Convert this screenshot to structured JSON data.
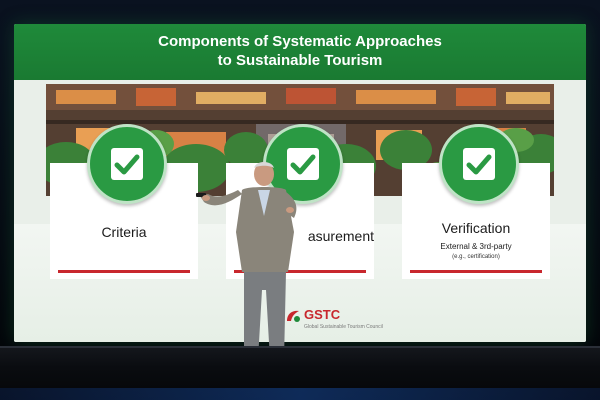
{
  "slide": {
    "title_line1": "Components of Systematic Approaches",
    "title_line2": "to Sustainable Tourism",
    "cards": [
      {
        "label": "Criteria",
        "subtitle": "",
        "note": ""
      },
      {
        "label": "Measurement",
        "visible_label": "asurement",
        "subtitle": "",
        "note": ""
      },
      {
        "label": "Verification",
        "subtitle": "External & 3rd-party",
        "note": "(e.g., certification)"
      }
    ],
    "logo": {
      "name": "GSTC",
      "tagline": "Global Sustainable Tourism Council",
      "visible_tagline": "Global Sustainable Tourism Council"
    }
  },
  "colors": {
    "header_green": "#1f8a3a",
    "badge_green": "#2a9a43",
    "accent_red": "#c8272d",
    "stage": "#0a0c10"
  },
  "icons": [
    "checkmark-icon",
    "gstc-logo-icon"
  ]
}
